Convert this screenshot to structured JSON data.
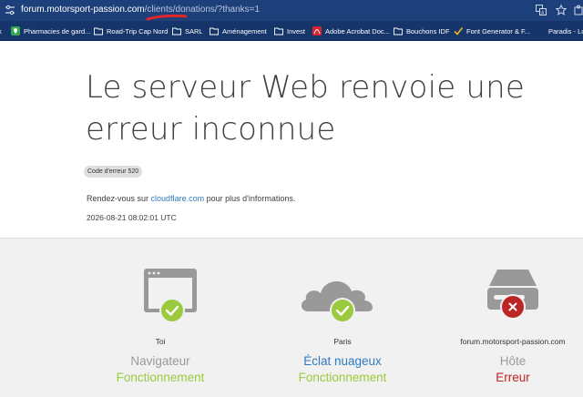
{
  "address_bar": {
    "url_main": "forum.motorsport-passion.com",
    "url_path": "/clients/donations/?thanks=1"
  },
  "bookmarks": [
    {
      "label": "Pharmacies de gard...",
      "icon": "map-pin-icon"
    },
    {
      "label": "Road-Trip Cap Nord",
      "icon": "folder-icon"
    },
    {
      "label": "SARL",
      "icon": "folder-icon"
    },
    {
      "label": "Aménagement",
      "icon": "folder-icon"
    },
    {
      "label": "Invest",
      "icon": "folder-icon"
    },
    {
      "label": "Adobe Acrobat Doc...",
      "icon": "pdf-icon"
    },
    {
      "label": "Bouchons IDF",
      "icon": "folder-icon"
    },
    {
      "label": "Font Generator & F...",
      "icon": "check-icon"
    },
    {
      "label": "Paradis - Loi",
      "icon": ""
    }
  ],
  "error": {
    "title": "Le serveur Web renvoie une erreur inconnue",
    "code": "Code d'erreur 520",
    "info_prefix": "Rendez-vous sur ",
    "info_link": "cloudflare.com",
    "info_suffix": " pour plus d'informations.",
    "timestamp": "2026-08-21 08:02:01 UTC"
  },
  "status": {
    "browser": {
      "location": "Toi",
      "kind": "Navigateur",
      "state": "Fonctionnement",
      "state_type": "ok"
    },
    "cloudflare": {
      "location": "Paris",
      "kind": "Éclat nuageux",
      "state": "Fonctionnement",
      "state_type": "ok"
    },
    "host": {
      "location": "forum.motorsport-passion.com",
      "kind": "Hôte",
      "state": "Erreur",
      "state_type": "error"
    }
  },
  "colors": {
    "ok": "#9bca3e",
    "error": "#bd2426",
    "link": "#2f7bbf",
    "address_bar": "#1d3f7a"
  }
}
